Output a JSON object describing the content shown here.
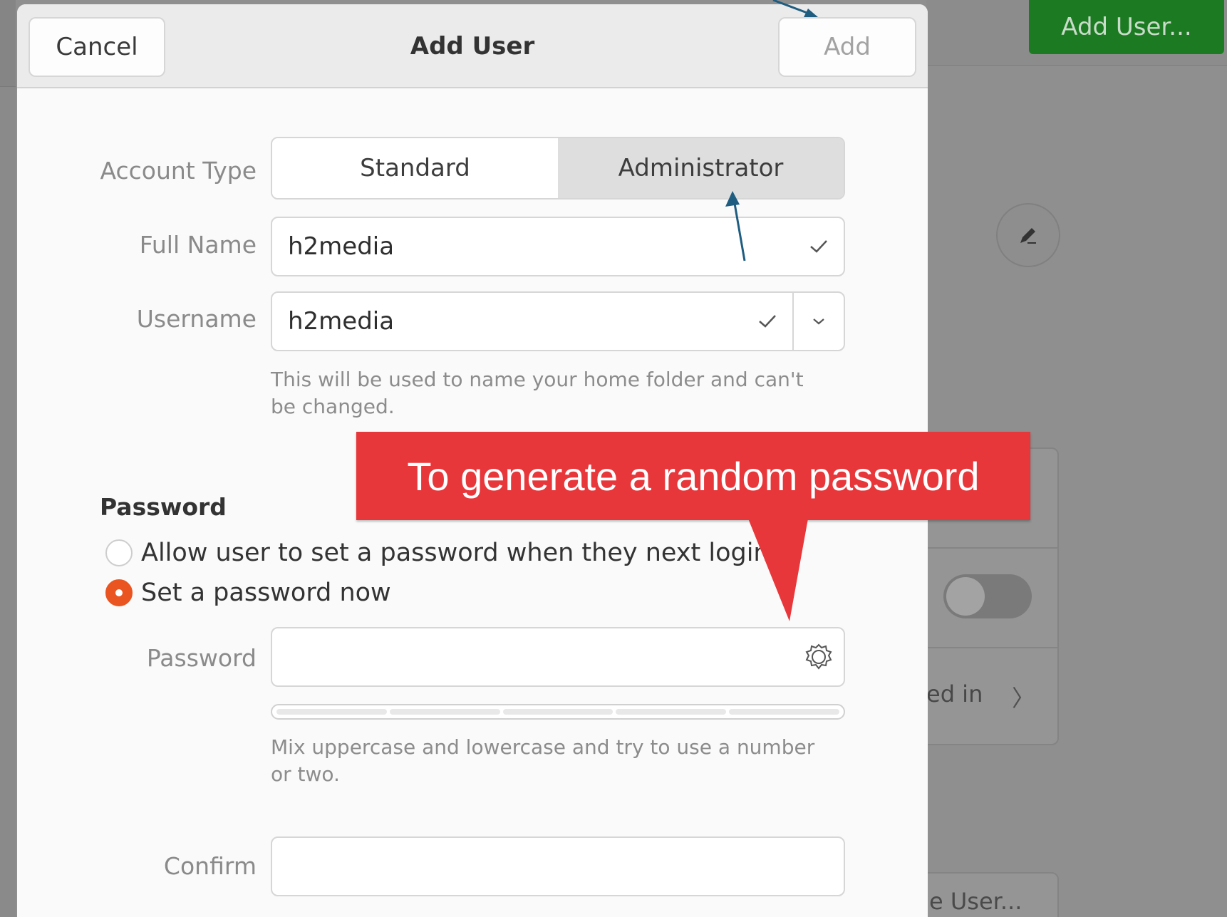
{
  "background": {
    "add_user_button": "Add User...",
    "logged_in_partial": "ed in",
    "chevron": "〉",
    "remove_user_partial": "e User..."
  },
  "dialog": {
    "title": "Add User",
    "cancel_label": "Cancel",
    "add_label": "Add",
    "account_type": {
      "label": "Account Type",
      "options": [
        "Standard",
        "Administrator"
      ],
      "selected": "Administrator"
    },
    "full_name": {
      "label": "Full Name",
      "value": "h2media"
    },
    "username": {
      "label": "Username",
      "value": "h2media",
      "hint": "This will be used to name your home folder and can't be changed."
    },
    "password_section": {
      "title": "Password",
      "option_later": "Allow user to set a password when they next login",
      "option_now": "Set a password now",
      "selected": "option_now",
      "password_label": "Password",
      "password_value": "",
      "hint": "Mix uppercase and lowercase and try to use a number or two.",
      "confirm_label": "Confirm",
      "confirm_value": ""
    }
  },
  "annotation": {
    "callout_text": "To generate a random password",
    "callout_color": "#e8373b",
    "arrow_color": "#1f5d80"
  },
  "colors": {
    "accent": "#e95420",
    "bg_green": "#1c7a22"
  }
}
